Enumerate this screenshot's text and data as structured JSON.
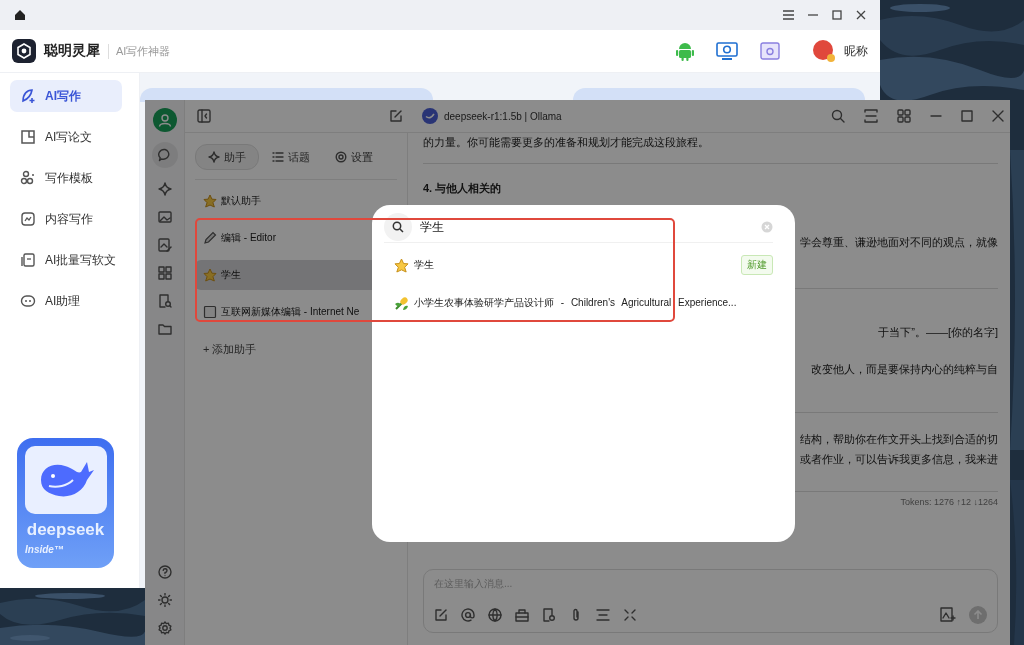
{
  "main_window": {
    "brand": "聪明灵犀",
    "subtitle": "AI写作神器",
    "user_name": "昵称",
    "nav": [
      {
        "label": "AI写作",
        "selected": true
      },
      {
        "label": "AI写论文",
        "selected": false
      },
      {
        "label": "写作模板",
        "selected": false
      },
      {
        "label": "内容写作",
        "selected": false
      },
      {
        "label": "AI批量写软文",
        "selected": false
      },
      {
        "label": "AI助理",
        "selected": false
      }
    ],
    "badge": {
      "name": "deepseek",
      "tag": "Inside™"
    }
  },
  "chat_window": {
    "model": "deepseek-r1:1.5b | Ollama",
    "tabs": [
      {
        "label": "助手",
        "selected": true
      },
      {
        "label": "话题",
        "selected": false
      },
      {
        "label": "设置",
        "selected": false
      }
    ],
    "assistants": [
      {
        "kind": "star",
        "label": "默认助手",
        "selected": false
      },
      {
        "kind": "pencil",
        "label": "编辑 - Editor",
        "selected": false
      },
      {
        "kind": "star",
        "label": "学生",
        "selected": true
      },
      {
        "kind": "doc",
        "label": "互联网新媒体编辑 - Internet Ne",
        "selected": false
      }
    ],
    "add_label": "+ 添加助手",
    "messages": [
      {
        "kind": "paragraph",
        "text": "的力量。你可能需要更多的准备和规划才能完成这段旅程。"
      },
      {
        "kind": "rule"
      },
      {
        "kind": "heading",
        "text": "4. 与他人相关的"
      },
      {
        "kind": "fragment",
        "text": "学会尊重、谦逊地面对不同的观点，就像"
      },
      {
        "kind": "rule"
      },
      {
        "kind": "fragment",
        "text": "于当下”。——[你的名字]"
      },
      {
        "kind": "fragment",
        "text": "改变他人，而是要保持内心的纯粹与自"
      },
      {
        "kind": "rule"
      },
      {
        "kind": "fragment",
        "text": "结构，帮助你在作文开头上找到合适的切"
      },
      {
        "kind": "fragment",
        "text": "或者作业，可以告诉我更多信息，我来进"
      },
      {
        "kind": "rule"
      }
    ],
    "tokens": "Tokens: 1276 ↑12 ↓1264",
    "input_placeholder": "在这里输入消息..."
  },
  "search_dialog": {
    "query": "学生",
    "results": [
      {
        "kind": "star",
        "label": "学生",
        "badge": "新建"
      },
      {
        "kind": "plant",
        "label": "小学生农事体验研学产品设计师 - Children's Agricultural Experience..."
      }
    ]
  }
}
